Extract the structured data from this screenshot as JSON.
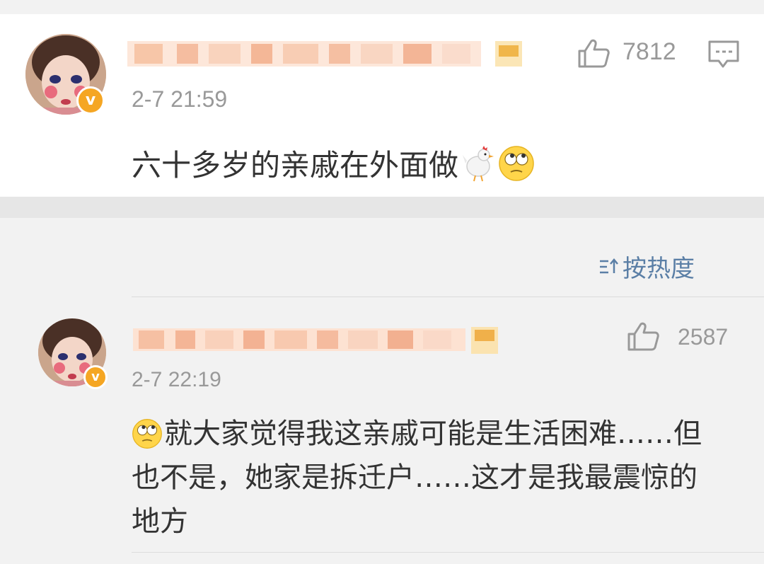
{
  "main_comment": {
    "time": "2-7 21:59",
    "likes": "7812",
    "text": "六十多岁的亲戚在外面做",
    "emojis": [
      "chicken-emoji",
      "face-with-rolling-eyes-emoji"
    ]
  },
  "sort": {
    "label": "按热度"
  },
  "reply": {
    "time": "2-7 22:19",
    "likes": "2587",
    "line1": "就大家觉得我这亲戚可能是生活困难……但",
    "line2": "也不是，她家是拆迁户……这才是我最震惊的",
    "line3": "地方",
    "leading_emoji": "face-with-rolling-eyes-emoji"
  },
  "colors": {
    "verified_badge": "#f5a623",
    "sort_text": "#5b7fa6",
    "meta_gray": "#999999",
    "username_blur": "#f6c7a8"
  }
}
